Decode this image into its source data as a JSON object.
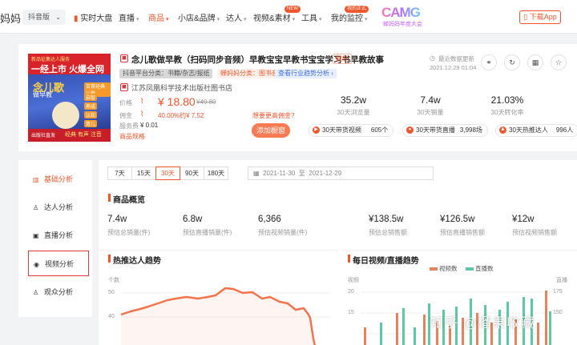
{
  "nav": {
    "logo_text": "妈妈",
    "version": "抖音版",
    "items": [
      {
        "label": "实时大盘",
        "icon": "bar-chart-icon"
      },
      {
        "label": "直播"
      },
      {
        "label": "商品"
      },
      {
        "label": "小店&品牌"
      },
      {
        "label": "达人"
      },
      {
        "label": "视频&素材",
        "badge": "NEW"
      },
      {
        "label": "工具"
      },
      {
        "label": "我的监控",
        "badge": "我的正式"
      }
    ],
    "promo_big": "CAMG",
    "promo_small": "蝉妈妈年度大会",
    "download": "下载App"
  },
  "product": {
    "cover": {
      "top_line": "新品征集达人服务",
      "headline": "一经上市 火爆全网",
      "title": "念儿歌",
      "subtitle": "做早教",
      "tags": [
        "百首经典儿歌",
        "启智",
        "养成",
        "认知",
        "育儿"
      ],
      "publisher": "出版社直发",
      "slogan": "经典 有声 注音"
    },
    "title": "念儿歌做早教（扫码同步音频）早教宝宝早教书宝宝学习书早教故事",
    "copy": "复制",
    "category_chip": "抖音平台分类：书籍/杂志/报纸",
    "cm_category_chip": "蝉妈妈分类：图书音像",
    "industry_chip": "查看行业趋势分析 ›",
    "shop": "江苏凤凰科学技术出版社图书店",
    "price_label": "价格",
    "price": "¥ 18.80",
    "old_price": "¥49.80",
    "commission_label": "佣金",
    "commission": "40.00%约¥ 7.52",
    "fee_label": "服务费",
    "fee": "¥ 0.01",
    "spec": "商品规格",
    "ask_price": "想要更高佣金?",
    "follow": "添加橱窗",
    "update_label": "最近数据更新",
    "update_time": "2021.12.29 01:04",
    "stats": [
      {
        "value": "35.2w",
        "label": "30天浏览量"
      },
      {
        "value": "7.4w",
        "label": "30天销量"
      },
      {
        "value": "21.03%",
        "label": "30天转化率"
      }
    ],
    "pills": [
      {
        "label": "30天带货视频",
        "value": "605个"
      },
      {
        "label": "30天带货直播",
        "value": "3,998场"
      },
      {
        "label": "30天热推达人",
        "value": "996人"
      }
    ]
  },
  "sidebar": {
    "items": [
      {
        "label": "基础分析"
      },
      {
        "label": "达人分析"
      },
      {
        "label": "直播分析"
      },
      {
        "label": "视频分析"
      },
      {
        "label": "观众分析"
      }
    ]
  },
  "main": {
    "ranges": [
      "7天",
      "15天",
      "30天",
      "90天",
      "180天"
    ],
    "date_from": "2021-11-30",
    "date_to": "2021-12-29",
    "date_sep": "至",
    "overview_title": "商品概览",
    "overview": [
      {
        "value": "7.4w",
        "label": "预估总销量(件)"
      },
      {
        "value": "6.8w",
        "label": "预估直播销量(件)"
      },
      {
        "value": "6,366",
        "label": "预估视频销量(件)"
      },
      {
        "value": "¥138.5w",
        "label": "预估总销售额"
      },
      {
        "value": "¥126.5w",
        "label": "预估直播销售额"
      },
      {
        "value": "¥12w",
        "label": "预估视频销售额"
      }
    ],
    "chart1_title": "热推达人趋势",
    "chart1_ylabel": "个数",
    "chart1_yticks": [
      "50",
      "40"
    ],
    "chart2_title": "每日视频/直播趋势",
    "chart2_ylabel_left": "视频",
    "chart2_ylabel_right": "直播",
    "chart2_yticks_left": [
      "20",
      "15"
    ],
    "chart2_yticks_right": [
      "175",
      "150"
    ],
    "legend_video": "视频数",
    "legend_live": "直播数",
    "color_video": "#e8825a",
    "color_live": "#5cc9a4"
  },
  "watermark": "知乎 @榴果收藏"
}
